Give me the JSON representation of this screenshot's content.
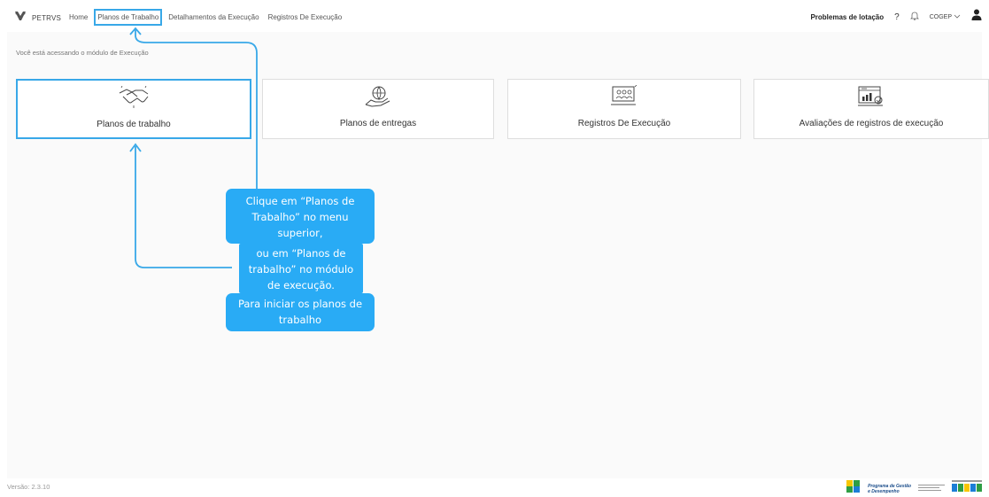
{
  "header": {
    "brand": "PETRVS",
    "nav": [
      {
        "label": "Home"
      },
      {
        "label": "Planos de Trabalho"
      },
      {
        "label": "Detalhamentos da Execução"
      },
      {
        "label": "Registros De Execução"
      }
    ],
    "problems_label": "Problemas de lotação",
    "help_label": "?",
    "unit_label": "COGEP"
  },
  "main": {
    "intro_text": "Você está acessando o módulo de Execução",
    "cards": [
      {
        "label": "Planos de trabalho",
        "icon": "handshake-icon"
      },
      {
        "label": "Planos de entregas",
        "icon": "globe-hand-icon"
      },
      {
        "label": "Registros De Execução",
        "icon": "monitor-team-icon"
      },
      {
        "label": "Avaliações de registros de execução",
        "icon": "chart-evaluation-icon"
      }
    ]
  },
  "callouts": {
    "c1": [
      "Clique em “Planos de",
      "Trabalho” no menu",
      "superior,"
    ],
    "c2": [
      "ou em “Planos de",
      "trabalho” no módulo",
      "de execução."
    ],
    "c3": [
      "Para iniciar os planos de",
      "trabalho"
    ]
  },
  "footer": {
    "version": "Versão: 2.3.10",
    "program_line1": "Programa de Gestão",
    "program_line2": "e Desempenho"
  },
  "colors": {
    "accent": "#38a8e8",
    "callout": "#29abf5"
  }
}
